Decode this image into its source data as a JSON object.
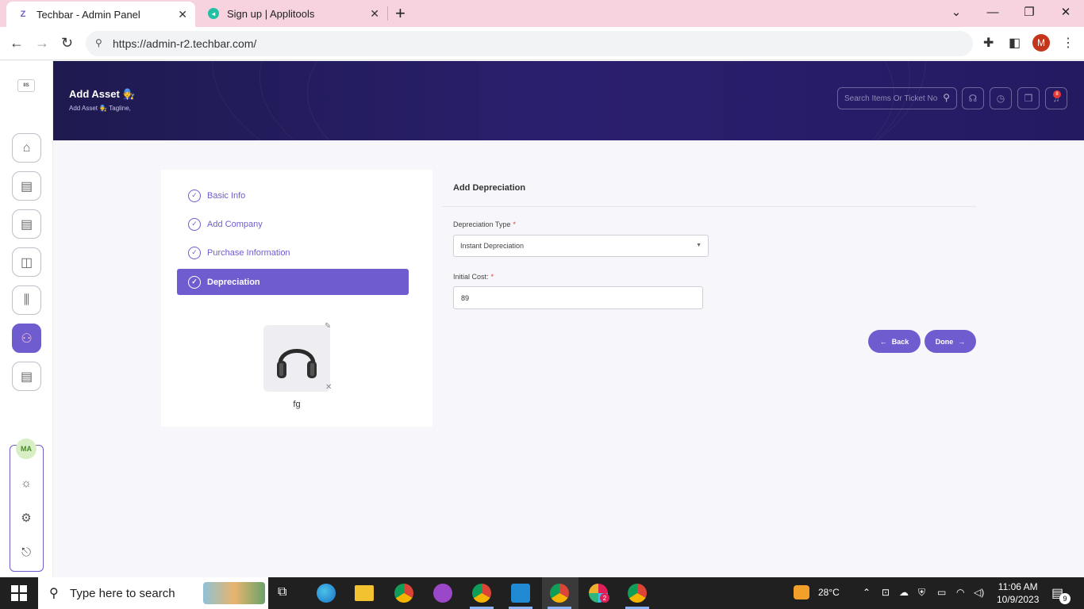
{
  "browser": {
    "tabs": [
      {
        "title": "Techbar - Admin Panel",
        "active": true
      },
      {
        "title": "Sign up | Applitools",
        "active": false
      }
    ],
    "url": "https://admin-r2.techbar.com/",
    "profile_initial": "M"
  },
  "sidebar": {
    "logo_text": "IIS",
    "user_initials": "MA"
  },
  "header": {
    "title": "Add Asset 🧑‍🔧",
    "tagline": "Add Asset 🧑‍🔧 Tagline,",
    "search_placeholder": "Search Items Or Ticket No",
    "notification_count": "8"
  },
  "stepper": {
    "steps": [
      {
        "label": "Basic Info",
        "active": false
      },
      {
        "label": "Add Company",
        "active": false
      },
      {
        "label": "Purchase Information",
        "active": false
      },
      {
        "label": "Depreciation",
        "active": true
      }
    ],
    "image_caption": "fg"
  },
  "form": {
    "title": "Add Depreciation",
    "depreciation_type_label": "Depreciation Type",
    "depreciation_type_value": "Instant Depreciation",
    "initial_cost_label": "Initial Cost:",
    "initial_cost_value": "89",
    "required_mark": "*",
    "back_label": "Back",
    "done_label": "Done"
  },
  "taskbar": {
    "search_placeholder": "Type here to search",
    "weather": "28°C",
    "time": "11:06 AM",
    "date": "10/9/2023",
    "notification_count": "9",
    "slack_badge": "2"
  },
  "colors": {
    "accent": "#6f5ccf",
    "banner": "#241a62"
  }
}
